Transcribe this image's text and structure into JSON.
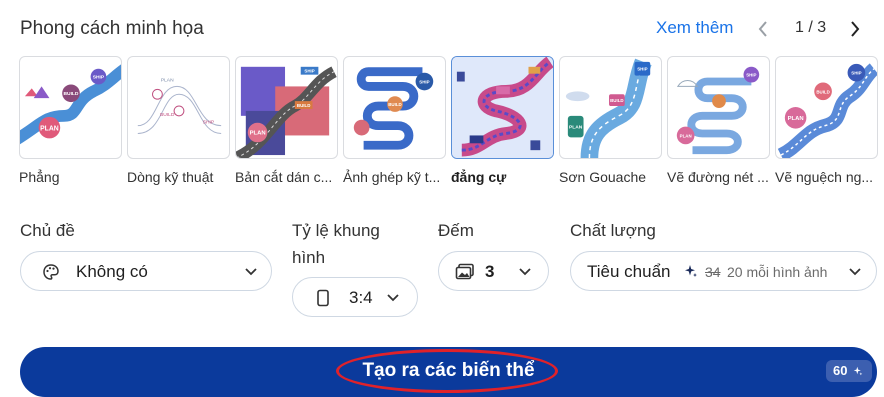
{
  "header": {
    "title": "Phong cách minh họa",
    "see_more": "Xem thêm",
    "prev_icon": "chevron-left-icon",
    "next_icon": "chevron-right-icon",
    "pager": "1 / 3"
  },
  "styles": [
    {
      "label": "Phẳng",
      "selected": false
    },
    {
      "label": "Dòng kỹ thuật",
      "selected": false
    },
    {
      "label": "Bản cắt dán c...",
      "selected": false
    },
    {
      "label": "Ảnh ghép kỹ t...",
      "selected": false
    },
    {
      "label": "đẳng cự",
      "selected": true
    },
    {
      "label": "Sơn Gouache",
      "selected": false
    },
    {
      "label": "Vẽ đường nét ...",
      "selected": false
    },
    {
      "label": "Vẽ nguệch ng...",
      "selected": false
    }
  ],
  "thumb_text": {
    "plan": "PLAN",
    "build": "BUILD",
    "ship": "SHIP"
  },
  "topic": {
    "label": "Chủ đề",
    "value": "Không có",
    "icon": "palette-icon"
  },
  "aspect": {
    "label_line1": "Tỷ lệ khung",
    "label_line2": "hình",
    "value": "3:4",
    "icon": "portrait-frame-icon"
  },
  "count": {
    "label": "Đếm",
    "value": "3",
    "icon": "image-stack-icon"
  },
  "quality": {
    "label": "Chất lượng",
    "value": "Tiêu chuẩn",
    "old_cost": "34",
    "cost_text": "20 mỗi hình ảnh",
    "icon": "sparkle-icon"
  },
  "generate": {
    "label": "Tạo ra các biến thể",
    "credits": "60"
  },
  "colors": {
    "accent": "#1a73e8",
    "button": "#0b3a9c",
    "annotation": "#e0222a"
  }
}
